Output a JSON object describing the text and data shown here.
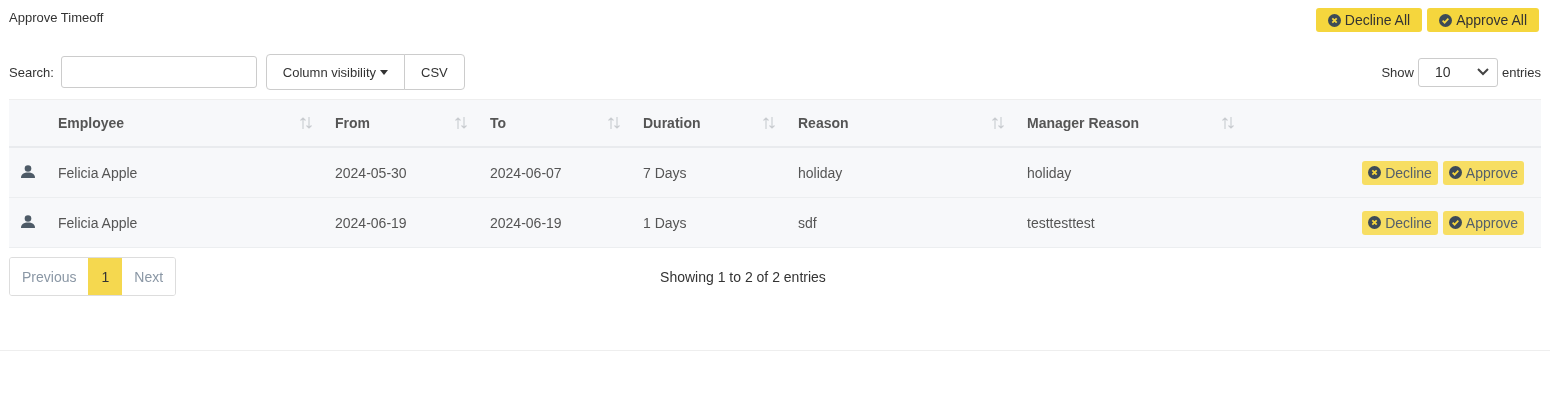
{
  "title": "Approve Timeoff",
  "header_buttons": [
    {
      "kind": "decline",
      "label": "Decline All"
    },
    {
      "kind": "approve",
      "label": "Approve All"
    }
  ],
  "search": {
    "label": "Search:"
  },
  "toolbar_buttons": [
    {
      "label": "Column visibility",
      "dropdown": true
    },
    {
      "label": "CSV",
      "dropdown": false
    }
  ],
  "length": {
    "prefix": "Show",
    "value": "10",
    "suffix": "entries"
  },
  "table": {
    "columns": [
      {
        "label": "Employee"
      },
      {
        "label": "From"
      },
      {
        "label": "To"
      },
      {
        "label": "Duration"
      },
      {
        "label": "Reason"
      },
      {
        "label": "Manager Reason"
      }
    ],
    "rows": [
      {
        "cells": [
          "Felicia Apple",
          "2024-05-30",
          "2024-06-07",
          "7 Days",
          "holiday",
          "holiday"
        ],
        "actions": [
          {
            "kind": "decline",
            "label": "Decline"
          },
          {
            "kind": "approve",
            "label": "Approve"
          }
        ]
      },
      {
        "cells": [
          "Felicia Apple",
          "2024-06-19",
          "2024-06-19",
          "1 Days",
          "sdf",
          "testtesttest"
        ],
        "actions": [
          {
            "kind": "decline",
            "label": "Decline"
          },
          {
            "kind": "approve",
            "label": "Approve"
          }
        ]
      }
    ]
  },
  "pagination": [
    {
      "label": "Previous",
      "selected": false
    },
    {
      "label": "1",
      "selected": true
    },
    {
      "label": "Next",
      "selected": false
    }
  ],
  "info": "Showing 1 to 2 of 2 entries"
}
